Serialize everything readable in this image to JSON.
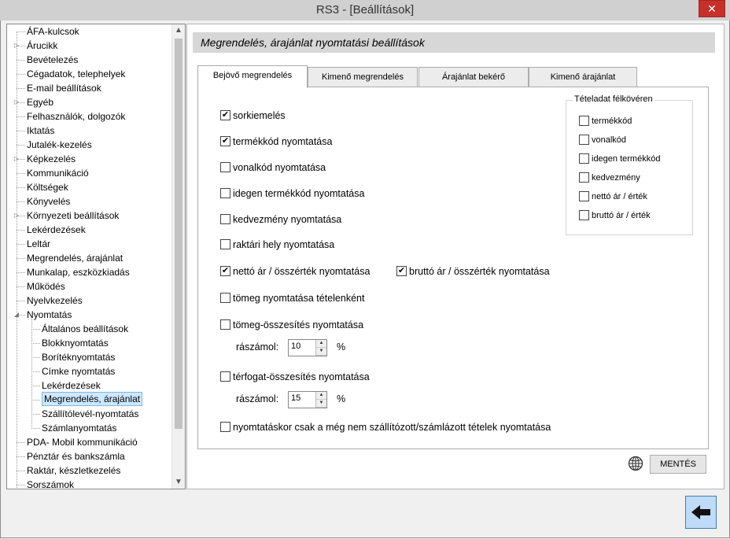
{
  "window": {
    "title": "RS3 - [Beállítások]",
    "close_label": "✕"
  },
  "tree": {
    "items": [
      {
        "label": "ÁFA-kulcsok",
        "level": 0,
        "expander": ""
      },
      {
        "label": "Árucikk",
        "level": 0,
        "expander": "▷"
      },
      {
        "label": "Bevételezés",
        "level": 0,
        "expander": ""
      },
      {
        "label": "Cégadatok, telephelyek",
        "level": 0,
        "expander": ""
      },
      {
        "label": "E-mail beállítások",
        "level": 0,
        "expander": ""
      },
      {
        "label": "Egyéb",
        "level": 0,
        "expander": "▷"
      },
      {
        "label": "Felhasználók, dolgozók",
        "level": 0,
        "expander": ""
      },
      {
        "label": "Iktatás",
        "level": 0,
        "expander": ""
      },
      {
        "label": "Jutalék-kezelés",
        "level": 0,
        "expander": ""
      },
      {
        "label": "Képkezelés",
        "level": 0,
        "expander": "▷"
      },
      {
        "label": "Kommunikáció",
        "level": 0,
        "expander": ""
      },
      {
        "label": "Költségek",
        "level": 0,
        "expander": ""
      },
      {
        "label": "Könyvelés",
        "level": 0,
        "expander": ""
      },
      {
        "label": "Környezeti beállítások",
        "level": 0,
        "expander": "▷"
      },
      {
        "label": "Lekérdezések",
        "level": 0,
        "expander": ""
      },
      {
        "label": "Leltár",
        "level": 0,
        "expander": ""
      },
      {
        "label": "Megrendelés, árajánlat",
        "level": 0,
        "expander": ""
      },
      {
        "label": "Munkalap, eszközkiadás",
        "level": 0,
        "expander": ""
      },
      {
        "label": "Működés",
        "level": 0,
        "expander": ""
      },
      {
        "label": "Nyelvkezelés",
        "level": 0,
        "expander": ""
      },
      {
        "label": "Nyomtatás",
        "level": 0,
        "expander": "◢"
      },
      {
        "label": "Általános beállítások",
        "level": 1,
        "expander": ""
      },
      {
        "label": "Blokknyomtatás",
        "level": 1,
        "expander": ""
      },
      {
        "label": "Borítéknyomtatás",
        "level": 1,
        "expander": ""
      },
      {
        "label": "Címke nyomtatás",
        "level": 1,
        "expander": ""
      },
      {
        "label": "Lekérdezések",
        "level": 1,
        "expander": ""
      },
      {
        "label": "Megrendelés, árajánlat",
        "level": 1,
        "expander": "",
        "selected": true
      },
      {
        "label": "Szállítólevél-nyomtatás",
        "level": 1,
        "expander": ""
      },
      {
        "label": "Számlanyomtatás",
        "level": 1,
        "expander": ""
      },
      {
        "label": "PDA- Mobil kommunikáció",
        "level": 0,
        "expander": ""
      },
      {
        "label": "Pénztár és bankszámla",
        "level": 0,
        "expander": ""
      },
      {
        "label": "Raktár, készletkezelés",
        "level": 0,
        "expander": ""
      },
      {
        "label": "Sorszámok",
        "level": 0,
        "expander": ""
      }
    ],
    "scroll_up": "▲",
    "scroll_down": "▼"
  },
  "pane": {
    "title": "Megrendelés, árajánlat nyomtatási beállítások",
    "tabs": [
      {
        "label": "Bejövő megrendelés",
        "active": true
      },
      {
        "label": "Kimenő megrendelés",
        "active": false
      },
      {
        "label": "Árajánlat bekérő",
        "active": false
      },
      {
        "label": "Kimenő árajánlat",
        "active": false
      }
    ],
    "options": [
      {
        "label": "sorkiemelés",
        "checked": true
      },
      {
        "label": "termékkód nyomtatása",
        "checked": true
      },
      {
        "label": "vonalkód nyomtatása",
        "checked": false
      },
      {
        "label": "idegen termékkód nyomtatása",
        "checked": false
      },
      {
        "label": "kedvezmény nyomtatása",
        "checked": false
      },
      {
        "label": "raktári hely nyomtatása",
        "checked": false
      },
      {
        "label": "nettó ár / összérték nyomtatása",
        "checked": true
      },
      {
        "label": "bruttó ár / összérték nyomtatása",
        "checked": true
      },
      {
        "label": "tömeg nyomtatása tételenként",
        "checked": false
      },
      {
        "label": "tömeg-összesítés nyomtatása",
        "checked": false
      },
      {
        "label": "térfogat-összesítés nyomtatása",
        "checked": false
      },
      {
        "label": "nyomtatáskor csak a még nem szállítózott/számlázott tételek nyomtatása",
        "checked": false
      }
    ],
    "spinners": [
      {
        "label": "rászámol:",
        "value": "10",
        "unit": "%"
      },
      {
        "label": "rászámol:",
        "value": "15",
        "unit": "%"
      }
    ],
    "group": {
      "title": "Tételadat félkövéren",
      "items": [
        {
          "label": "termékkód",
          "checked": false
        },
        {
          "label": "vonalkód",
          "checked": false
        },
        {
          "label": "idegen termékkód",
          "checked": false
        },
        {
          "label": "kedvezmény",
          "checked": false
        },
        {
          "label": "nettó ár / érték",
          "checked": false
        },
        {
          "label": "bruttó ár / érték",
          "checked": false
        }
      ]
    },
    "save_label": "MENTÉS"
  }
}
